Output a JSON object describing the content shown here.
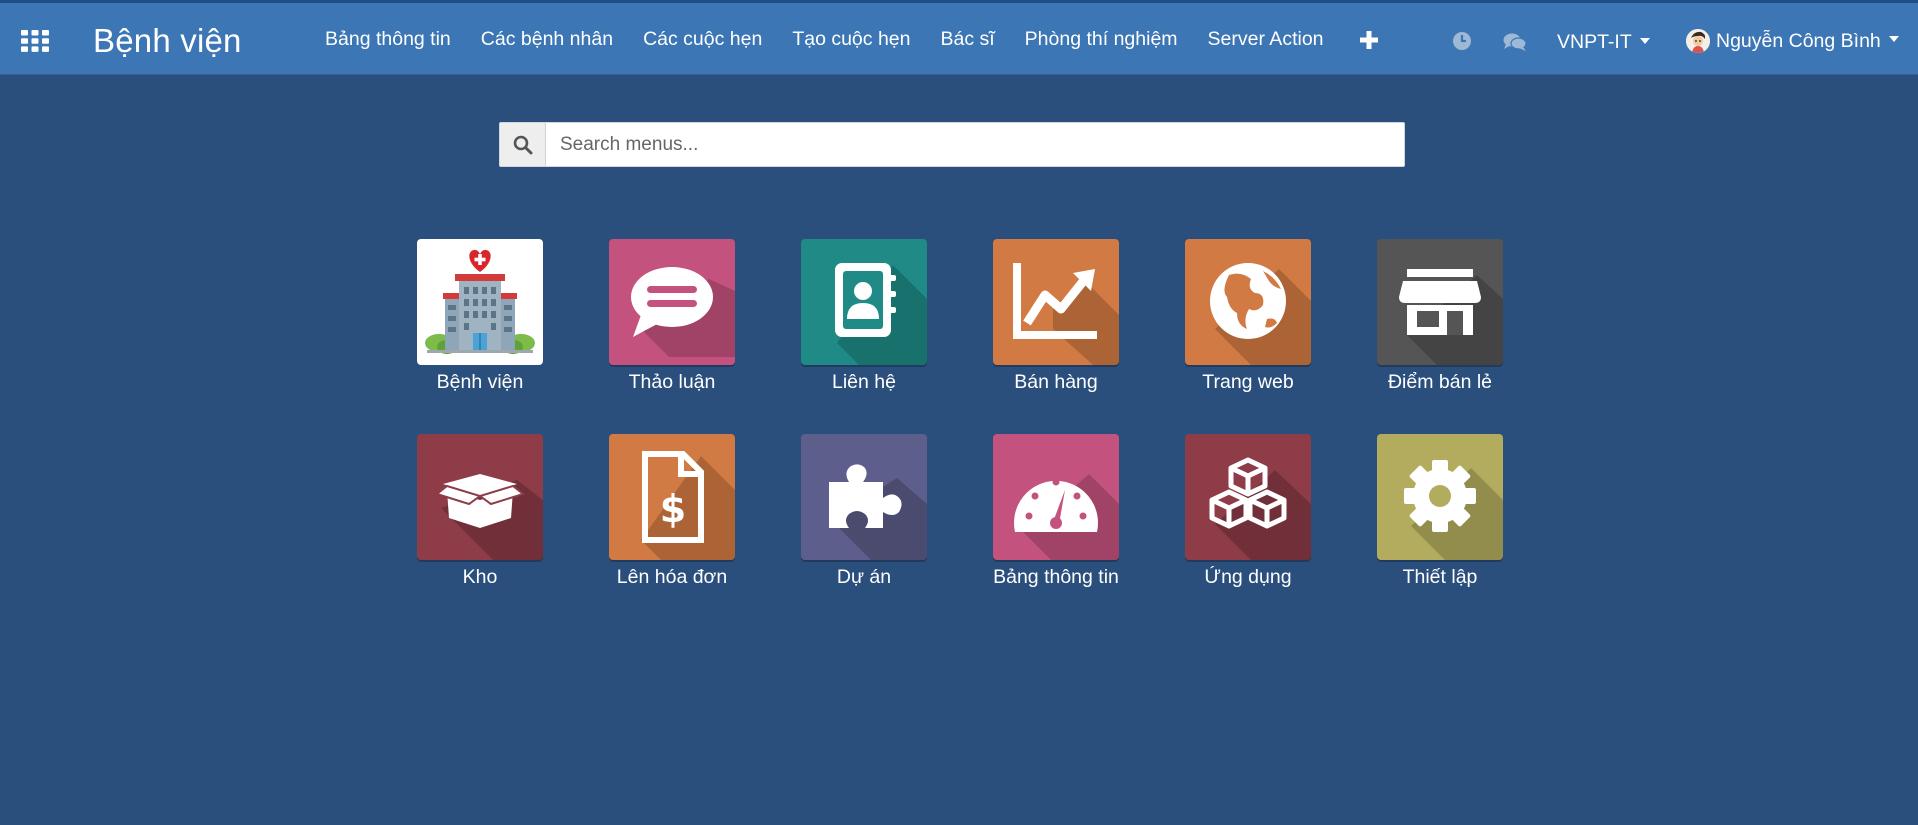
{
  "navbar": {
    "brand": "Bệnh viện",
    "menu": [
      "Bảng thông tin",
      "Các bệnh nhân",
      "Các cuộc hẹn",
      "Tạo cuộc hẹn",
      "Bác sĩ",
      "Phòng thí nghiệm",
      "Server Action"
    ],
    "company": "VNPT-IT",
    "user": "Nguyễn Công Bình",
    "icons": [
      "apps-grid-icon",
      "plus-icon",
      "clock-icon",
      "chat-icon",
      "caret-down-icon",
      "avatar"
    ]
  },
  "search": {
    "placeholder": "Search menus...",
    "icon": "search-icon"
  },
  "apps": [
    {
      "label": "Bệnh viện",
      "icon": "hospital-icon",
      "color": "#ffffff"
    },
    {
      "label": "Thảo luận",
      "icon": "speech-bubble-icon",
      "color": "#c4527e"
    },
    {
      "label": "Liên hệ",
      "icon": "address-book-icon",
      "color": "#1f8a86"
    },
    {
      "label": "Bán hàng",
      "icon": "trend-chart-icon",
      "color": "#d27a44"
    },
    {
      "label": "Trang web",
      "icon": "globe-icon",
      "color": "#d27a44"
    },
    {
      "label": "Điểm bán lẻ",
      "icon": "store-icon",
      "color": "#555555"
    },
    {
      "label": "Kho",
      "icon": "open-box-icon",
      "color": "#8e3c48"
    },
    {
      "label": "Lên hóa đơn",
      "icon": "invoice-icon",
      "color": "#d27a44"
    },
    {
      "label": "Dự án",
      "icon": "puzzle-icon",
      "color": "#5e5e8c"
    },
    {
      "label": "Bảng thông tin",
      "icon": "gauge-icon",
      "color": "#c4527e"
    },
    {
      "label": "Ứng dụng",
      "icon": "cubes-icon",
      "color": "#8e3c48"
    },
    {
      "label": "Thiết lập",
      "icon": "gear-icon",
      "color": "#b3ac5e"
    }
  ]
}
